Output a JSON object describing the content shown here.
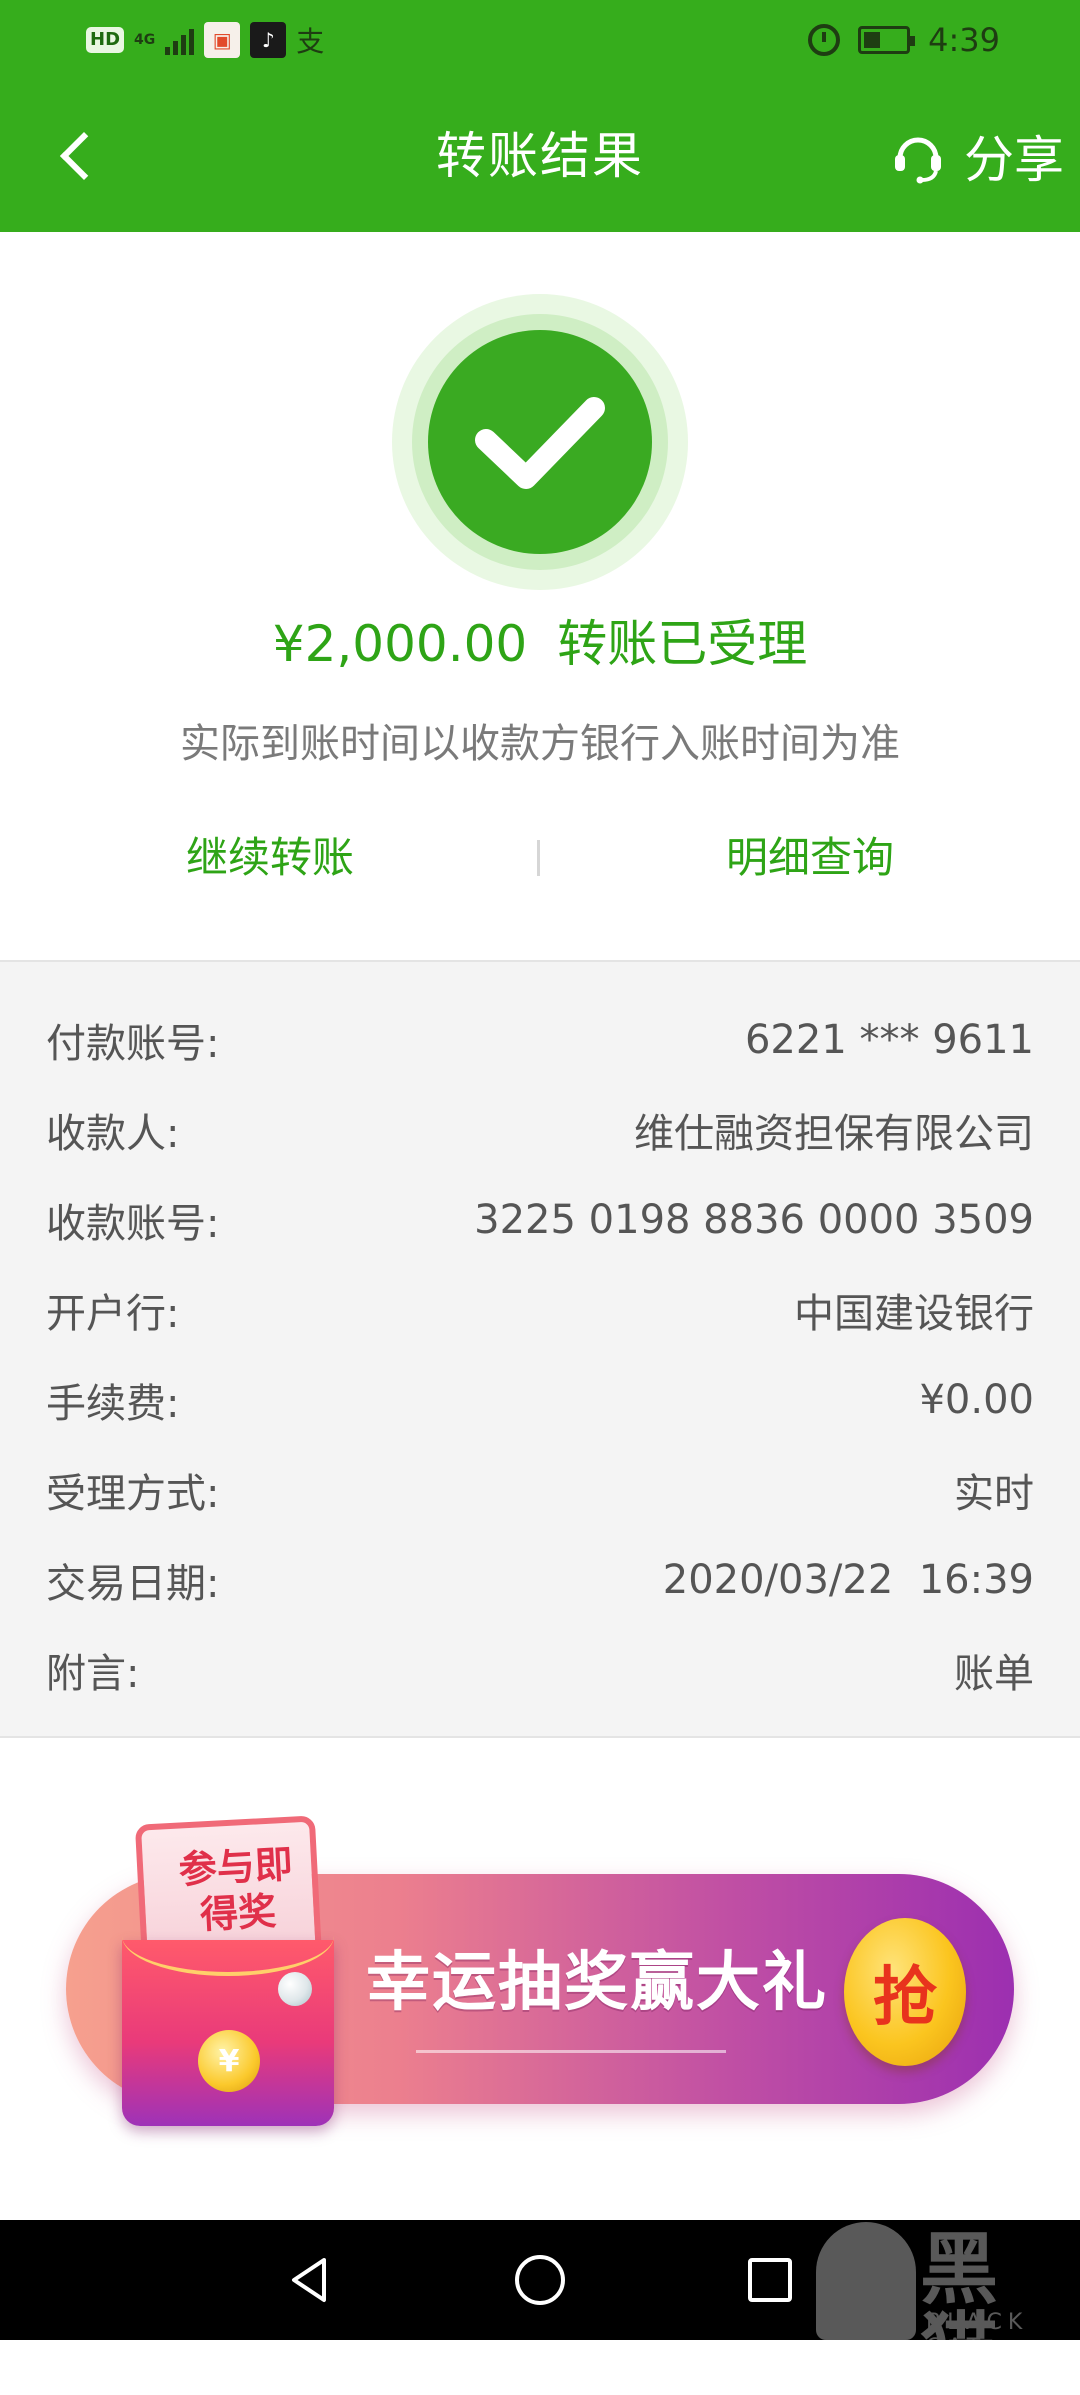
{
  "status_bar": {
    "hd": "HD",
    "network": "4G",
    "time": "4:39",
    "zhi_glyph": "支",
    "tiktok_glyph": "♪"
  },
  "header": {
    "title": "转账结果",
    "share_label": "分享"
  },
  "result": {
    "amount": "¥2,000.00",
    "status": "转账已受理",
    "note": "实际到账时间以收款方银行入账时间为准",
    "continue_label": "继续转账",
    "detail_label": "明细查询"
  },
  "details": {
    "rows": [
      {
        "label": "付款账号:",
        "value": "6221 *** 9611"
      },
      {
        "label": "收款人:",
        "value": "维仕融资担保有限公司"
      },
      {
        "label": "收款账号:",
        "value": "3225 0198 8836 0000 3509"
      },
      {
        "label": "开户行:",
        "value": "中国建设银行"
      },
      {
        "label": "手续费:",
        "value": "¥0.00"
      },
      {
        "label": "受理方式:",
        "value": "实时"
      },
      {
        "label": "交易日期:",
        "value": "2020/03/22  16:39"
      },
      {
        "label": "附言:",
        "value": "账单"
      }
    ]
  },
  "promo": {
    "envelope_text_1": "参与即",
    "envelope_text_2": "得奖",
    "headline": "幸运抽奖赢大礼",
    "grab_label": "抢",
    "coin_glyph": "¥"
  },
  "watermark": {
    "text": "黑猫",
    "sub": "BLACK CAT"
  },
  "colors": {
    "header_green": "#36ad1c",
    "accent_green": "#2ea416",
    "detail_bg": "#f4f4f4"
  }
}
